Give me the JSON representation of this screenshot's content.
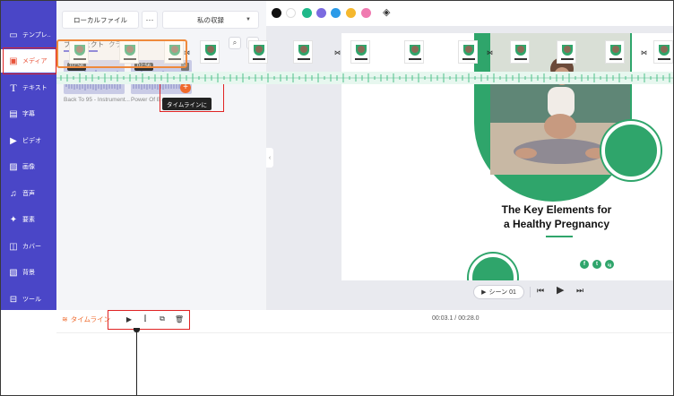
{
  "sidebar": {
    "items": [
      {
        "label": "テンプレ..",
        "icon": "template-icon"
      },
      {
        "label": "メディア",
        "icon": "media-icon"
      },
      {
        "label": "テキスト",
        "icon": "text-icon"
      },
      {
        "label": "字幕",
        "icon": "subtitle-icon"
      },
      {
        "label": "ビデオ",
        "icon": "video-icon"
      },
      {
        "label": "画像",
        "icon": "image-icon"
      },
      {
        "label": "音声",
        "icon": "audio-icon"
      },
      {
        "label": "要素",
        "icon": "elements-icon"
      },
      {
        "label": "カバー",
        "icon": "cover-icon"
      },
      {
        "label": "背景",
        "icon": "background-icon"
      },
      {
        "label": "ツール",
        "icon": "tools-icon"
      }
    ]
  },
  "media_panel": {
    "local_files": "ローカルファイル",
    "more": "···",
    "my_collection": "私の収録",
    "tabs": [
      "プロジェクト",
      "クラウド"
    ],
    "clips": [
      {
        "duration": "02:58",
        "name": "Back To 95 - Instrument..."
      },
      {
        "duration": "02:56",
        "name": "Power Of B..."
      }
    ],
    "add_to_timeline_tooltip": "タイムラインに"
  },
  "color_toolbar": {
    "colors": [
      "#111111",
      "#ffffff",
      "#1fb98a",
      "#7b6be0",
      "#2b9ae8",
      "#f5b82e",
      "#f07ab0"
    ]
  },
  "slide": {
    "title_line1": "The Key Elements for",
    "title_line2": "a Healthy Pregnancy",
    "social": [
      "f",
      "t",
      "ig"
    ],
    "accent": "#2fa56b"
  },
  "playback": {
    "scene_label": "シーン 01"
  },
  "timeline": {
    "label": "タイムライン",
    "time": "00:03.1 / 00:28.0"
  }
}
